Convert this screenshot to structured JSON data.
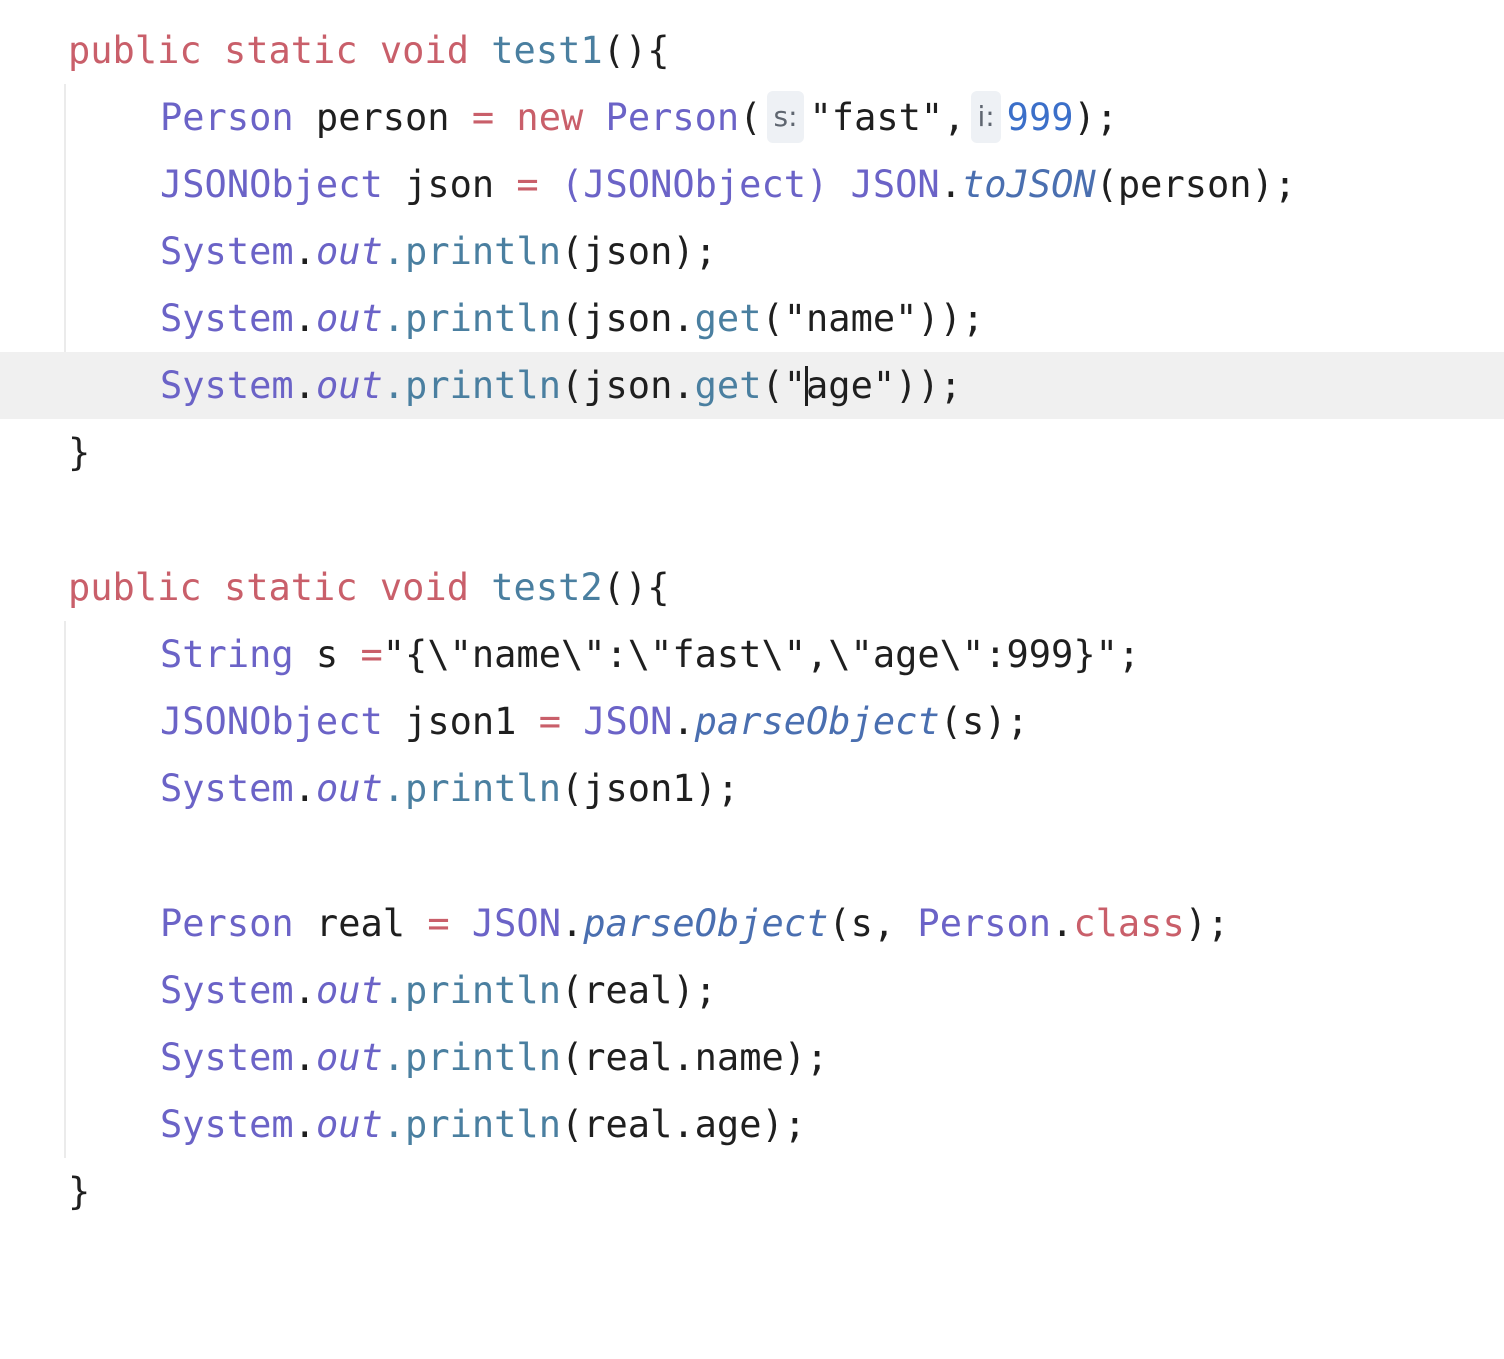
{
  "code": {
    "test1": {
      "signature": {
        "kw_public": "public",
        "kw_static": "static",
        "kw_void": "void",
        "name": "test1",
        "tail": "(){"
      },
      "line1": {
        "type": "Person",
        "var": " person ",
        "eq": "=",
        "kw_new": " new ",
        "ctor": "Person",
        "open": "(",
        "hint_s": "s:",
        "str": "\"fast\",",
        "hint_i": "i:",
        "num": "999",
        "close": ");"
      },
      "line2": {
        "type": "JSONObject",
        "var": " json ",
        "eq": "=",
        "cast": " (JSONObject) ",
        "cls": "JSON",
        "dot": ".",
        "method": "toJSON",
        "args": "(person);"
      },
      "line3": {
        "cls": "System",
        "dot": ".",
        "field": "out",
        "call": ".println",
        "args": "(json);"
      },
      "line4": {
        "cls": "System",
        "dot": ".",
        "field": "out",
        "call": ".println",
        "args_a": "(json.",
        "get": "get",
        "args_b": "(\"name\"));"
      },
      "line5": {
        "cls": "System",
        "dot": ".",
        "field": "out",
        "call": ".println",
        "args_a": "(json.",
        "get": "get",
        "args_b": "(\"",
        "args_c": "age\"));"
      },
      "close": "}"
    },
    "test2": {
      "signature": {
        "kw_public": "public",
        "kw_static": "static",
        "kw_void": "void",
        "name": "test2",
        "tail": "(){"
      },
      "line1": {
        "type": "String",
        "var": " s ",
        "eq": "=",
        "str": "\"{\\\"name\\\":\\\"fast\\\",\\\"age\\\":999}\";"
      },
      "line2": {
        "type": "JSONObject",
        "var": " json1 ",
        "eq": "=",
        "cls": " JSON",
        "dot": ".",
        "method": "parseObject",
        "args": "(s);"
      },
      "line3": {
        "cls": "System",
        "dot": ".",
        "field": "out",
        "call": ".println",
        "args": "(json1);"
      },
      "line4": {
        "type": "Person",
        "var": " real ",
        "eq": "=",
        "cls": " JSON",
        "dot": ".",
        "method": "parseObject",
        "args_a": "(s, ",
        "type2": "Person",
        "dot2": ".",
        "kw_class": "class",
        "args_b": ");"
      },
      "line5": {
        "cls": "System",
        "dot": ".",
        "field": "out",
        "call": ".println",
        "args": "(real);"
      },
      "line6": {
        "cls": "System",
        "dot": ".",
        "field": "out",
        "call": ".println",
        "args": "(real.name);"
      },
      "line7": {
        "cls": "System",
        "dot": ".",
        "field": "out",
        "call": ".println",
        "args": "(real.age);"
      },
      "close": "}"
    }
  },
  "colors": {
    "keyword": "#c95f6a",
    "type": "#6b63c7",
    "method_call": "#4a6fb0",
    "number": "#3b6fc9",
    "text": "#1f1f1f",
    "current_line": "#f0f0f0"
  }
}
